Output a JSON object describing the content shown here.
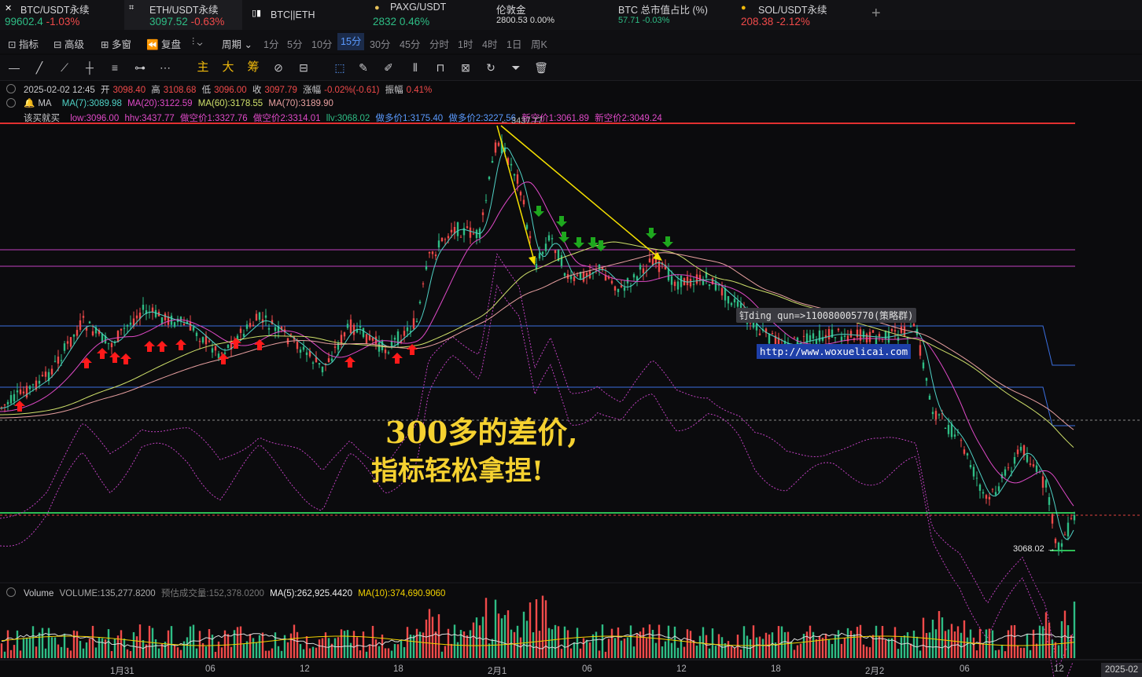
{
  "tabs": [
    {
      "name": "BTC/USDT永续",
      "price": "99602.4",
      "change": "-1.03%",
      "dir": "up",
      "changeDir": "dn"
    },
    {
      "name": "ETH/USDT永续",
      "price": "3097.52",
      "change": "-0.63%",
      "dir": "up",
      "changeDir": "dn"
    },
    {
      "name": "BTC||ETH",
      "price": "",
      "change": "",
      "dir": "up",
      "changeDir": "up"
    },
    {
      "name": "PAXG/USDT",
      "price": "2832",
      "change": "0.46%",
      "dir": "up",
      "changeDir": "up"
    },
    {
      "name": "伦敦金",
      "price": "2800.53",
      "change": "0.00%",
      "dir": "plain",
      "changeDir": "plain"
    },
    {
      "name": "BTC 总市值占比 (%)",
      "price": "57.71",
      "change": "-0.03%",
      "dir": "up",
      "changeDir": "up"
    },
    {
      "name": "SOL/USDT永续",
      "price": "208.38",
      "change": "-2.12%",
      "dir": "dn",
      "changeDir": "dn"
    }
  ],
  "toolbar": {
    "indicator": "指标",
    "advanced": "高级",
    "multiwin": "多窗",
    "replay": "复盘",
    "period": "周期",
    "intervals": [
      "1分",
      "5分",
      "10分",
      "15分",
      "30分",
      "45分",
      "分时",
      "1时",
      "4时",
      "1日",
      "周K"
    ],
    "selected_interval": "15分",
    "zoom": "0s"
  },
  "drawtools": {
    "main": "主",
    "big": "大",
    "chip": "筹"
  },
  "ohlc": {
    "time": "2025-02-02 12:45",
    "open_label": "开",
    "open": "3098.40",
    "high_label": "高",
    "high": "3108.68",
    "low_label": "低",
    "low": "3096.00",
    "close_label": "收",
    "close": "3097.79",
    "chg_label": "涨幅",
    "chg": "-0.02%(-0.61)",
    "amp_label": "振幅",
    "amp": "0.41%"
  },
  "ma": {
    "label": "MA",
    "ma7": "MA(7):3089.98",
    "ma20": "MA(20):3122.59",
    "ma60": "MA(60):3178.55",
    "ma70": "MA(70):3189.90"
  },
  "indicator": {
    "name": "该买就买",
    "low": "low:3096.00",
    "hhv": "hhv:3437.77",
    "short1": "做空价1:3327.76",
    "short2": "做空价2:3314.01",
    "llv": "llv:3068.02",
    "long1": "做多价1:3175.40",
    "long2": "做多价2:3227.56",
    "newshort1": "新空价1:3061.89",
    "newshort2": "新空价2:3049.24"
  },
  "volume": {
    "label": "Volume",
    "vol": "VOLUME:135,277.8200",
    "est": "预估成交量:152,378.0200",
    "ma5": "MA(5):262,925.4420",
    "ma10": "MA(10):374,690.9060"
  },
  "annotations": {
    "line1": "300多的差价,",
    "line2": "指标轻松拿捏!",
    "wm_contact": "钉ding qun=>110080005770(策略群)",
    "wm_url": "http://www.woxuelicai.com",
    "high_label": "← 3437.77",
    "low_label": "3068.02 →"
  },
  "xaxis": [
    "1月31",
    "06",
    "12",
    "18",
    "2月1",
    "06",
    "12",
    "18",
    "2月2",
    "06",
    "12"
  ],
  "date_box": "2025-02",
  "colors": {
    "up": "#2ebd85",
    "down": "#f04a4a",
    "accent": "#5b9bff",
    "ma7": "#4fd1c5",
    "ma20": "#e04ac8",
    "ma60": "#cfe06a",
    "ma70": "#e8a0a0"
  }
}
